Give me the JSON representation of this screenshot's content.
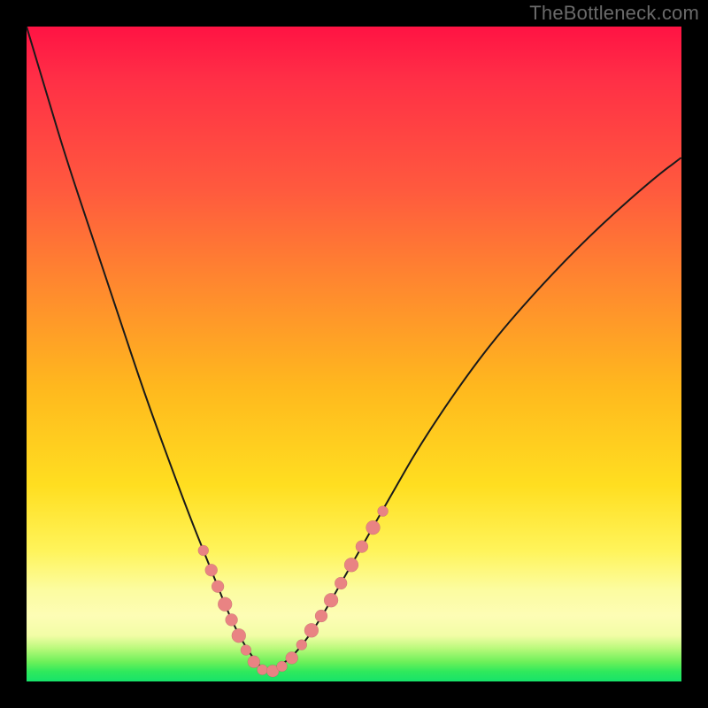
{
  "watermark": "TheBottleneck.com",
  "chart_data": {
    "type": "line",
    "title": "",
    "xlabel": "",
    "ylabel": "",
    "xlim": [
      0,
      100
    ],
    "ylim": [
      0,
      100
    ],
    "series": [
      {
        "name": "curve",
        "x": [
          0,
          3,
          6,
          10,
          14,
          18,
          22,
          25,
          27,
          29,
          31,
          33,
          35,
          36.5,
          40,
          44,
          48,
          52,
          56,
          60,
          66,
          72,
          80,
          88,
          96,
          100
        ],
        "values": [
          100,
          90,
          80,
          68,
          56,
          44,
          33,
          25,
          20,
          15,
          10,
          6,
          3,
          1.5,
          3,
          8,
          15,
          22,
          29,
          36,
          45,
          53,
          62,
          70,
          77,
          80
        ]
      }
    ],
    "minimum": {
      "x": 36.5,
      "value": 1.5
    },
    "beads_left": [
      {
        "x": 27.0,
        "y": 20.0,
        "r": 6
      },
      {
        "x": 28.2,
        "y": 17.0,
        "r": 7
      },
      {
        "x": 29.2,
        "y": 14.5,
        "r": 7
      },
      {
        "x": 30.3,
        "y": 11.8,
        "r": 8
      },
      {
        "x": 31.3,
        "y": 9.4,
        "r": 7
      },
      {
        "x": 32.4,
        "y": 7.0,
        "r": 8
      },
      {
        "x": 33.5,
        "y": 4.8,
        "r": 6
      },
      {
        "x": 34.7,
        "y": 3.0,
        "r": 7
      },
      {
        "x": 36.0,
        "y": 1.8,
        "r": 6
      },
      {
        "x": 37.6,
        "y": 1.6,
        "r": 7
      },
      {
        "x": 39.0,
        "y": 2.3,
        "r": 6
      }
    ],
    "beads_right": [
      {
        "x": 40.5,
        "y": 3.6,
        "r": 7
      },
      {
        "x": 42.0,
        "y": 5.6,
        "r": 6
      },
      {
        "x": 43.5,
        "y": 7.8,
        "r": 8
      },
      {
        "x": 45.0,
        "y": 10.0,
        "r": 7
      },
      {
        "x": 46.5,
        "y": 12.4,
        "r": 8
      },
      {
        "x": 48.0,
        "y": 15.0,
        "r": 7
      },
      {
        "x": 49.6,
        "y": 17.8,
        "r": 8
      },
      {
        "x": 51.2,
        "y": 20.6,
        "r": 7
      },
      {
        "x": 52.9,
        "y": 23.5,
        "r": 8
      },
      {
        "x": 54.4,
        "y": 26.0,
        "r": 6
      }
    ],
    "legend": null,
    "grid": false
  },
  "colors": {
    "bead": "#e98383",
    "curve": "#1a1a1a"
  }
}
